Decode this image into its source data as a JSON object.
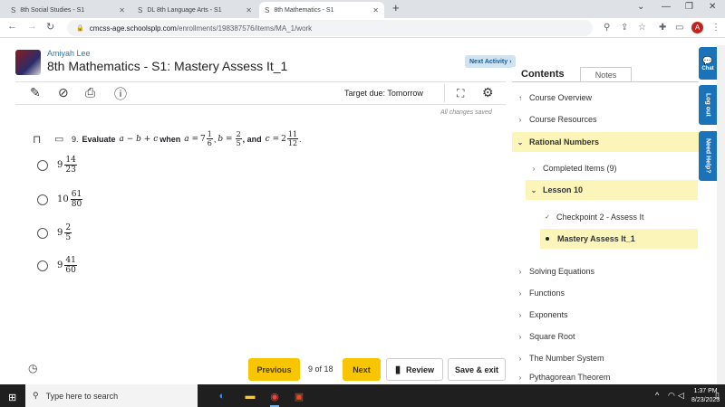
{
  "browser": {
    "tabs": [
      {
        "label": "8th Social Studies - S1",
        "active": false
      },
      {
        "label": "DL 8th Language Arts - S1",
        "active": false
      },
      {
        "label": "8th Mathematics - S1",
        "active": true
      }
    ],
    "url_host": "cmcss-age.schoolsplp.com",
    "url_path": "/enrollments/198387576/items/MA_1/work",
    "profile_initial": "A"
  },
  "header": {
    "user_name": "Amiyah Lee",
    "title": "8th Mathematics - S1: Mastery Assess It_1",
    "next_activity": "Next Activity ›"
  },
  "toolbar": {
    "target_due": "Target due: Tomorrow",
    "saved_status": "All changes saved"
  },
  "question": {
    "number": "9.",
    "prefix": "Evaluate",
    "expr": "a − b + c",
    "when": "when",
    "a_var": "a =",
    "a_whole": "7",
    "a_num": "1",
    "a_den": "6",
    "b_var": "b =",
    "b_num": "2",
    "b_den": "5",
    "and": ", and",
    "c_var": "c =",
    "c_whole": "2",
    "c_num": "11",
    "c_den": "12",
    "end": "."
  },
  "options": [
    {
      "whole": "9",
      "num": "14",
      "den": "23"
    },
    {
      "whole": "10",
      "num": "61",
      "den": "80"
    },
    {
      "whole": "9",
      "num": "2",
      "den": "5"
    },
    {
      "whole": "9",
      "num": "41",
      "den": "60"
    }
  ],
  "footer": {
    "previous": "Previous",
    "counter": "9 of 18",
    "next": "Next",
    "review": "Review",
    "save_exit": "Save & exit"
  },
  "sidebar": {
    "tab_contents": "Contents",
    "tab_notes": "Notes",
    "items": [
      {
        "label": "Course Overview",
        "chevron": "↑"
      },
      {
        "label": "Course Resources",
        "chevron": "›"
      },
      {
        "label": "Rational Numbers",
        "chevron": "⌄"
      },
      {
        "label": "Completed Items (9)",
        "chevron": "›"
      },
      {
        "label": "Lesson 10",
        "chevron": "⌄"
      },
      {
        "label": "Checkpoint 2 - Assess It",
        "chevron": "✓"
      },
      {
        "label": "Mastery Assess It_1",
        "chevron": "•"
      },
      {
        "label": "Solving Equations",
        "chevron": "›"
      },
      {
        "label": "Functions",
        "chevron": "›"
      },
      {
        "label": "Exponents",
        "chevron": "›"
      },
      {
        "label": "Square Root",
        "chevron": "›"
      },
      {
        "label": "The Number System",
        "chevron": "›"
      },
      {
        "label": "Pythagorean Theorem",
        "chevron": "›"
      }
    ]
  },
  "side_tabs": {
    "chat": "Chat",
    "logout": "Log out",
    "help": "Need Help?"
  },
  "taskbar": {
    "search_placeholder": "Type here to search",
    "time": "1:37 PM",
    "date": "8/23/2023"
  }
}
